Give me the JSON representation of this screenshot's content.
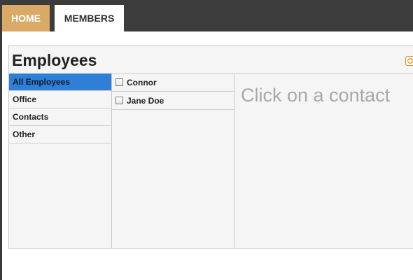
{
  "nav": {
    "tabs": [
      {
        "label": "HOME"
      },
      {
        "label": "MEMBERS"
      }
    ],
    "active_tab": "MEMBERS"
  },
  "panel": {
    "title": "Employees",
    "add_icon": "add-circle-icon"
  },
  "categories": [
    {
      "label": "All Employees"
    },
    {
      "label": "Office"
    },
    {
      "label": "Contacts"
    },
    {
      "label": "Other"
    }
  ],
  "selected_category": "All Employees",
  "contacts": [
    {
      "name": "Connor",
      "checked": false
    },
    {
      "name": "Jane Doe",
      "checked": false
    }
  ],
  "detail": {
    "placeholder": "Click on a contact"
  },
  "colors": {
    "topbar": "#3c3c3c",
    "home_tab": "#dba966",
    "active_category": "#2f7fd6",
    "add_icon": "#f29a26",
    "placeholder_text": "#a8a8a8"
  }
}
